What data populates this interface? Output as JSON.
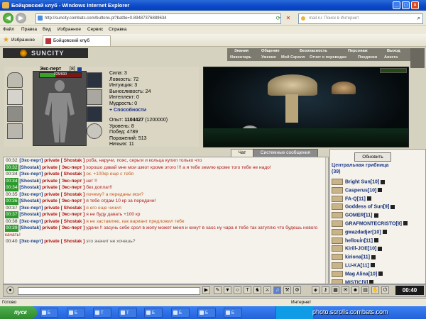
{
  "window": {
    "title": "Бойцовский клуб - Windows Internet Explorer",
    "url": "http://suncity.combats.com/buttons.pl?battle=0.89487376889634",
    "search_placeholder": "mail.ru: Поиск в Интернет"
  },
  "menu": [
    "Файл",
    "Правка",
    "Вид",
    "Избранное",
    "Сервис",
    "Справка"
  ],
  "favorites": {
    "label": "Избранное",
    "tab_title": "Бойцовский клуб"
  },
  "site": {
    "logo": "SUNCITY"
  },
  "topnav": {
    "row1": [
      "Знания",
      "Общение",
      "Безопасность",
      "Персонаж",
      "Выход"
    ],
    "row2": [
      "Инвентарь",
      "Умения",
      "Мой Скролл",
      "Отчет о переводах",
      "Поединки",
      "Анкета"
    ]
  },
  "character": {
    "name": "Экс-перт",
    "level": "[8]",
    "hp": "225/600",
    "hp_fraction": 0.375,
    "stats": [
      "Сила: 3",
      "Ловкость: 72",
      "Интуиция: 3",
      "Выносливость: 24",
      "Интеллект: 0",
      "Мудрость: 0"
    ],
    "abilities_link": "+ Способности",
    "exp_label": "Опыт:",
    "exp_value": "1104427",
    "exp_next": "(1200000)",
    "progress": [
      "Уровень: 8",
      "Побед: 4789",
      "Поражений: 513",
      "Ничьих: 11"
    ]
  },
  "chat_tabs": {
    "chat": "Чат",
    "system": "Системные сообщения"
  },
  "chat": [
    {
      "time": "00:32",
      "hl": false,
      "from": "[Экс-перт]",
      "to": "private [ Shostak ]",
      "text": "роба, наручи, пояс, серьги и кольца купил только что",
      "style": "red"
    },
    {
      "time": "00:32",
      "hl": true,
      "from": "[Shostak]",
      "to": "private [ Экс-перт ]",
      "text": "хорошо давай мне мои шмот кроме этого !!! а я тебе землю кроме того тебе не надо!",
      "style": "red"
    },
    {
      "time": "00:34",
      "hl": false,
      "from": "[Экс-перт]",
      "to": "private [ Shostak ]",
      "text": "ок. +100кр еще с тебя",
      "style": "orange"
    },
    {
      "time": "00:34",
      "hl": true,
      "from": "[Shostak]",
      "to": "private [ Экс-перт ]",
      "text": "нет !!",
      "style": "red"
    },
    {
      "time": "00:34",
      "hl": true,
      "from": "[Shostak]",
      "to": "private [ Экс-перт ]",
      "text": "без доплат!!",
      "style": "red"
    },
    {
      "time": "00:35",
      "hl": false,
      "from": "[Экс-перт]",
      "to": "private [ Shostak ]",
      "text": "почему? а переданы мои?",
      "style": "orange"
    },
    {
      "time": "00:36",
      "hl": true,
      "from": "[Shostak]",
      "to": "private [ Экс-перт ]",
      "text": "я тебе отдам 10 кр за передачи!",
      "style": "red"
    },
    {
      "time": "00:37",
      "hl": false,
      "from": "[Экс-перт]",
      "to": "private [ Shostak ]",
      "text": "я его еще чинил",
      "style": "orange"
    },
    {
      "time": "00:37",
      "hl": true,
      "from": "[Shostak]",
      "to": "private [ Экс-перт ]",
      "text": "я не буду давать +100 кр",
      "style": "red"
    },
    {
      "time": "00:38",
      "hl": false,
      "from": "[Экс-перт]",
      "to": "private [ Shostak ]",
      "text": "я не заставляю, как вариант предложил тебе",
      "style": "orange"
    },
    {
      "time": "00:39",
      "hl": true,
      "from": "[Shostak]",
      "to": "private [ Экс-перт ]",
      "text": "удачи !! засунь себе срол в жопу может меня и кинут в хаос ну чара я тебе так затуплю что будешь нового качать!",
      "style": "red"
    },
    {
      "time": "00:40",
      "hl": false,
      "from": "[Экс-перт]",
      "to": "private [ Shostak ]",
      "text": "это значит не хочешь?",
      "style": "gray"
    }
  ],
  "room": {
    "refresh": "Обновить",
    "title": "Центральная грибница",
    "count": "(39)",
    "players": [
      {
        "name": "Bright Sun",
        "lvl": "[10]"
      },
      {
        "name": "Casperus",
        "lvl": "[10]"
      },
      {
        "name": "FA-Q",
        "lvl": "[11]"
      },
      {
        "name": "Goddess of Sun",
        "lvl": "[9]"
      },
      {
        "name": "GOMER",
        "lvl": "[11]"
      },
      {
        "name": "GRAFMONTECRISTO",
        "lvl": "[9]"
      },
      {
        "name": "gwazdadjer",
        "lvl": "[10]"
      },
      {
        "name": "helloui̇n",
        "lvl": "[11]"
      },
      {
        "name": "Kirill-JOE",
        "lvl": "[10]"
      },
      {
        "name": "kiriona",
        "lvl": "[11]"
      },
      {
        "name": "LU-KA",
        "lvl": "[11]"
      },
      {
        "name": "Mag Alina",
        "lvl": "[10]"
      },
      {
        "name": "MISTIC",
        "lvl": "[9]"
      }
    ]
  },
  "toolbar": {
    "clock": "00:40"
  },
  "status": {
    "left": "Готово",
    "zone": "Интернет"
  },
  "taskbar": {
    "start": "пуск",
    "tasks": [
      "Б",
      "Б",
      "Т",
      "Т",
      "Б",
      "Б",
      "Б",
      "Б"
    ],
    "watermark": "photo.scrolls.combats.com"
  }
}
